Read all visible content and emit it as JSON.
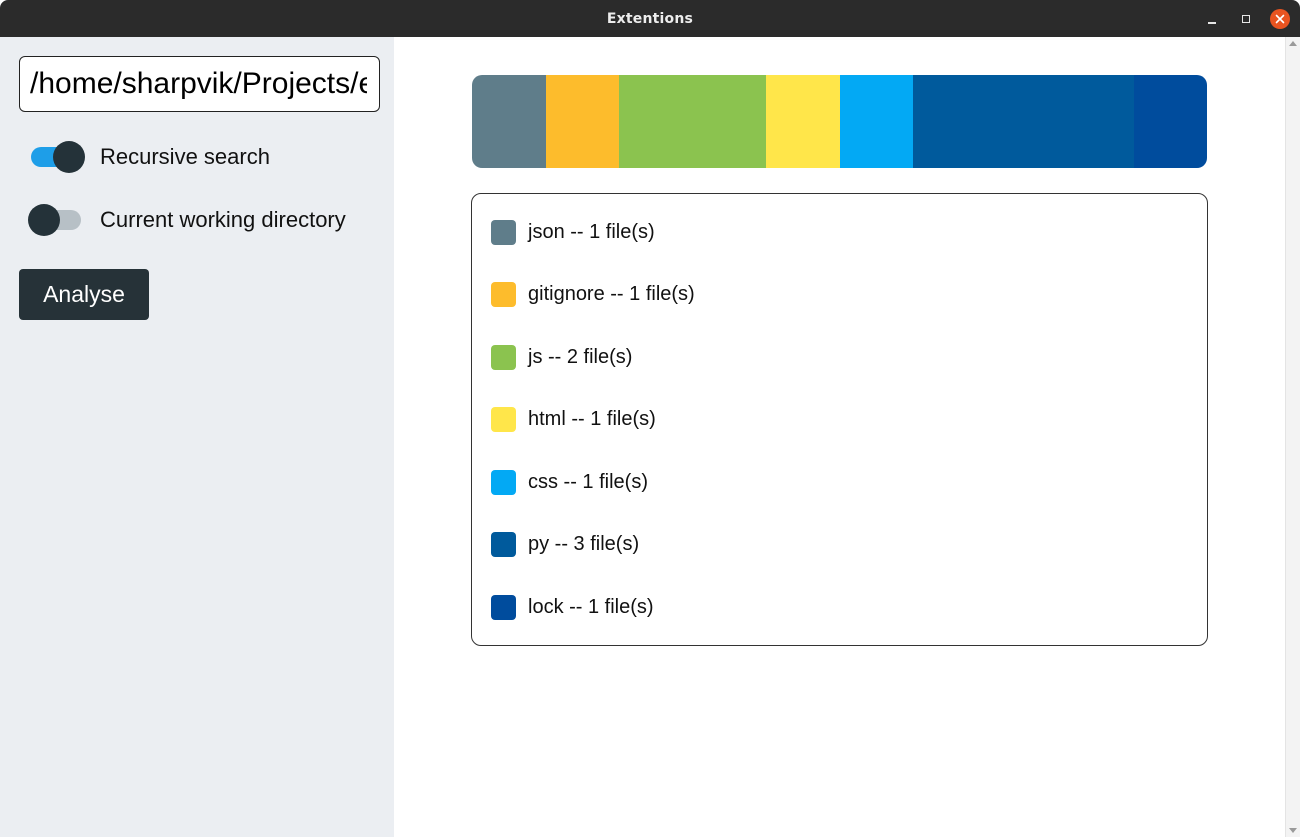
{
  "window": {
    "title": "Extentions"
  },
  "sidebar": {
    "path_value": "/home/sharpvik/Projects/extentions",
    "recursive": {
      "label": "Recursive search",
      "on": true
    },
    "cwd": {
      "label": "Current working directory",
      "on": false
    },
    "analyse_label": "Analyse"
  },
  "summary": {
    "items": [
      {
        "ext": "json",
        "count": 1,
        "label": "json -- 1 file(s)",
        "color": "#5f7d8a"
      },
      {
        "ext": "gitignore",
        "count": 1,
        "label": "gitignore -- 1 file(s)",
        "color": "#fdbc2c"
      },
      {
        "ext": "js",
        "count": 2,
        "label": "js -- 2 file(s)",
        "color": "#8bc34f"
      },
      {
        "ext": "html",
        "count": 1,
        "label": "html -- 1 file(s)",
        "color": "#ffe64a"
      },
      {
        "ext": "css",
        "count": 1,
        "label": "css -- 1 file(s)",
        "color": "#03a9f4"
      },
      {
        "ext": "py",
        "count": 3,
        "label": "py -- 3 file(s)",
        "color": "#005a9c"
      },
      {
        "ext": "lock",
        "count": 1,
        "label": "lock -- 1 file(s)",
        "color": "#004c9d"
      }
    ]
  },
  "icons": {
    "minimize": "minimize-icon",
    "maximize": "maximize-icon",
    "close": "close-icon"
  }
}
